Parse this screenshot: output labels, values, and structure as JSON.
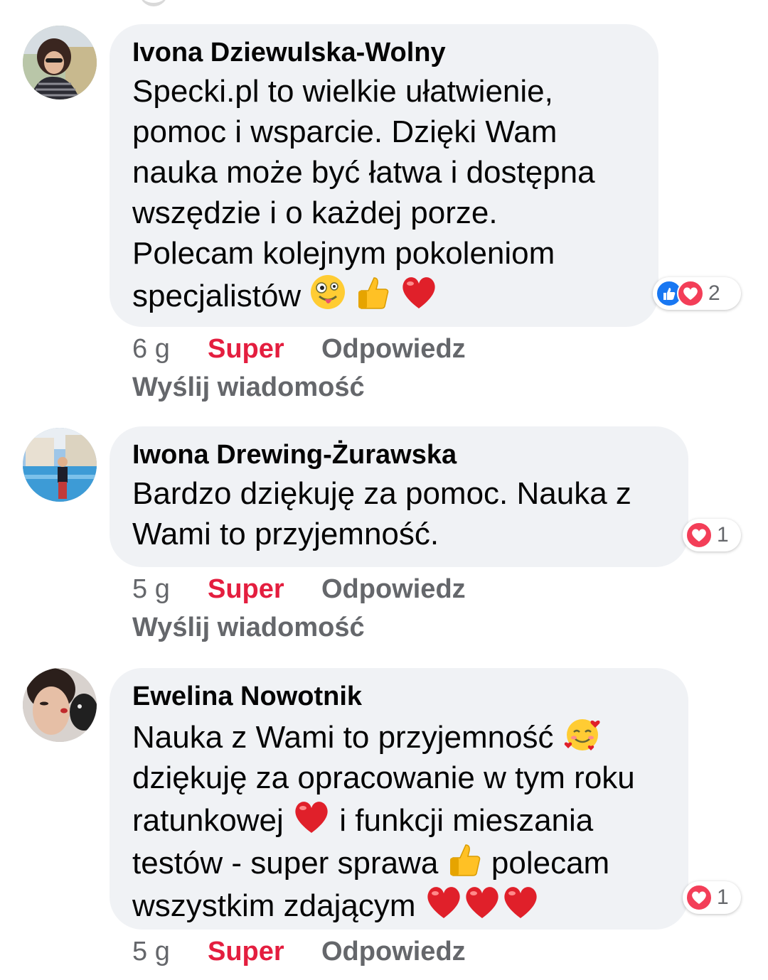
{
  "comments": [
    {
      "author": "Ivona Dziewulska-Wolny",
      "lines": [
        "Specki.pl to wielkie ułatwienie,",
        "pomoc i wsparcie. Dzięki Wam",
        "nauka może być łatwa i dostępna",
        "wszędzie i o każdej porze.",
        "Polecam kolejnym pokoleniom",
        "specjalistów"
      ],
      "reaction_icons": [
        "like-icon",
        "love-icon"
      ],
      "reaction_count": "2",
      "time": "6 g",
      "super_label": "Super",
      "reply_label": "Odpowiedz",
      "send_label": "Wyślij wiadomość"
    },
    {
      "author": "Iwona Drewing-Żurawska",
      "lines": [
        "Bardzo dziękuję za pomoc. Nauka z",
        "Wami to przyjemność."
      ],
      "reaction_icons": [
        "love-icon"
      ],
      "reaction_count": "1",
      "time": "5 g",
      "super_label": "Super",
      "reply_label": "Odpowiedz",
      "send_label": "Wyślij wiadomość"
    },
    {
      "author": "Ewelina Nowotnik",
      "lines": [
        "Nauka z Wami to przyjemność",
        "dziękuję za opracowanie w tym roku",
        "ratunkowej",
        "i funkcji mieszania",
        "testów - super sprawa",
        "polecam",
        "wszystkim zdającym"
      ],
      "reaction_icons": [
        "love-icon"
      ],
      "reaction_count": "1",
      "time": "5 g",
      "super_label": "Super",
      "reply_label": "Odpowiedz"
    }
  ],
  "colors": {
    "bubble": "#f0f2f5",
    "super": "#e41e3f",
    "meta": "#65676b",
    "like": "#1877f2",
    "love": "#f33e58"
  }
}
